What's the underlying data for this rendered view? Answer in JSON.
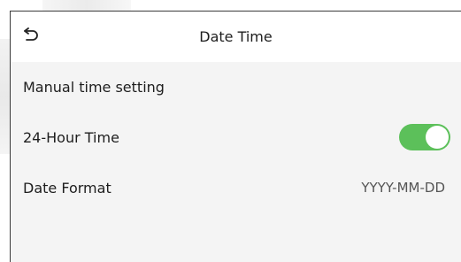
{
  "header": {
    "title": "Date Time"
  },
  "settings": {
    "manual_time": {
      "label": "Manual time setting"
    },
    "hour24": {
      "label": "24-Hour Time",
      "enabled": true,
      "on_color": "#5cc05a"
    },
    "date_format": {
      "label": "Date Format",
      "value": "YYYY-MM-DD"
    }
  },
  "icons": {
    "back": "back-arrow-icon"
  }
}
